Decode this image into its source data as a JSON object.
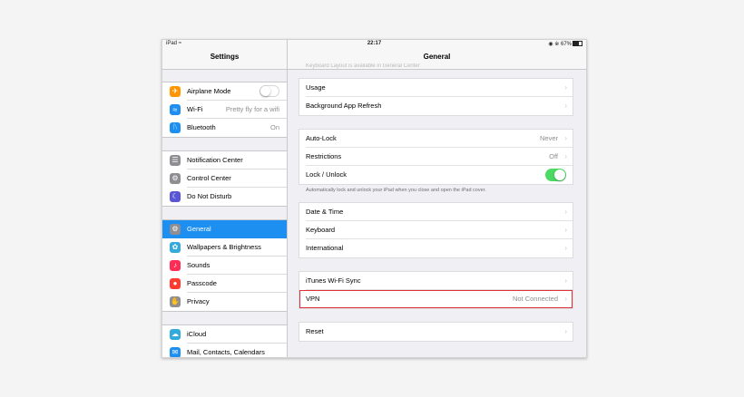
{
  "status_bar": {
    "device": "iPad",
    "time": "22:17",
    "battery": "67%"
  },
  "sidebar": {
    "title": "Settings",
    "groups": [
      {
        "items": [
          {
            "label": "Airplane Mode",
            "icon": "airplane-icon",
            "color": "#ff9500"
          },
          {
            "label": "Wi-Fi",
            "value": "Pretty fly for a wifi",
            "icon": "wifi-icon",
            "color": "#1d8ff0"
          },
          {
            "label": "Bluetooth",
            "value": "On",
            "icon": "bluetooth-icon",
            "color": "#1d8ff0"
          }
        ]
      },
      {
        "items": [
          {
            "label": "Notification Center",
            "icon": "notification-icon",
            "color": "#8e8e93"
          },
          {
            "label": "Control Center",
            "icon": "control-center-icon",
            "color": "#8e8e93"
          },
          {
            "label": "Do Not Disturb",
            "icon": "moon-icon",
            "color": "#5856d6"
          }
        ]
      },
      {
        "items": [
          {
            "label": "General",
            "icon": "gear-icon",
            "color": "#8e8e93",
            "selected": true
          },
          {
            "label": "Wallpapers & Brightness",
            "icon": "wallpaper-icon",
            "color": "#34aadc"
          },
          {
            "label": "Sounds",
            "icon": "speaker-icon",
            "color": "#ff2d55"
          },
          {
            "label": "Passcode",
            "icon": "passcode-icon",
            "color": "#ff3b30"
          },
          {
            "label": "Privacy",
            "icon": "hand-icon",
            "color": "#8e8e93"
          }
        ]
      },
      {
        "items": [
          {
            "label": "iCloud",
            "icon": "cloud-icon",
            "color": "#34aadc"
          },
          {
            "label": "Mail, Contacts, Calendars",
            "icon": "mail-icon",
            "color": "#1d8ff0"
          }
        ]
      }
    ]
  },
  "detail": {
    "title": "General",
    "clipped_text": "Keyboard Layout is available in General Center",
    "groups": [
      {
        "rows": [
          {
            "label": "Usage"
          },
          {
            "label": "Background App Refresh"
          }
        ]
      },
      {
        "rows": [
          {
            "label": "Auto-Lock",
            "value": "Never"
          },
          {
            "label": "Restrictions",
            "value": "Off"
          },
          {
            "label": "Lock / Unlock"
          }
        ],
        "footnote": "Automatically lock and unlock your iPad when you close and open the iPad cover."
      },
      {
        "rows": [
          {
            "label": "Date & Time"
          },
          {
            "label": "Keyboard"
          },
          {
            "label": "International"
          }
        ]
      },
      {
        "rows": [
          {
            "label": "iTunes Wi-Fi Sync"
          },
          {
            "label": "VPN",
            "value": "Not Connected"
          }
        ]
      },
      {
        "rows": [
          {
            "label": "Reset"
          }
        ]
      }
    ]
  },
  "colors": {
    "accent": "#1d8ff0",
    "toggle_on": "#4cd964",
    "highlight": "#e0313b"
  }
}
